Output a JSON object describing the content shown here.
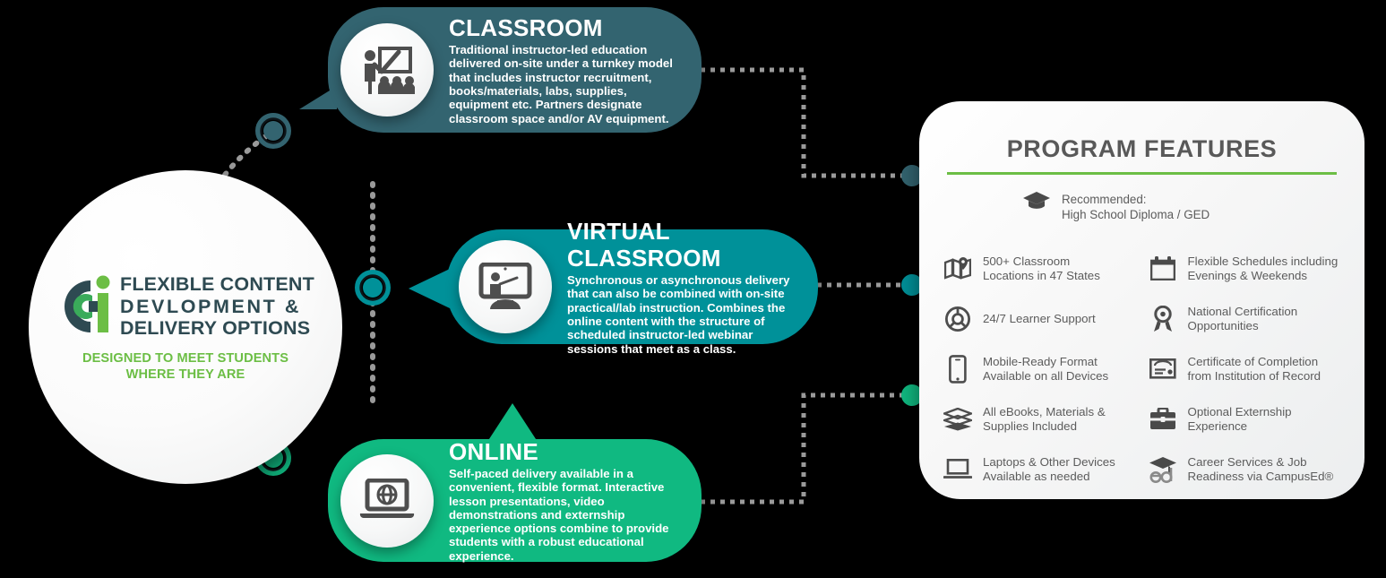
{
  "hub": {
    "logo_name": "cci-logo",
    "title_line1": "FLEXIBLE CONTENT",
    "title_line2": "DEVLOPMENT &",
    "title_line3": "DELIVERY OPTIONS",
    "subtitle_line1": "DESIGNED TO MEET STUDENTS",
    "subtitle_line2": "WHERE THEY ARE",
    "title_color": "#2e4a52",
    "subtitle_color": "#6cbe45"
  },
  "cards": [
    {
      "key": "classroom",
      "heading": "CLASSROOM",
      "body": "Traditional instructor-led education delivered on-site under a turnkey model that includes instructor recruitment, books/materials, labs, supplies, equipment etc. Partners designate classroom space and/or AV equipment.",
      "color": "#336470",
      "icon": "instructor-whiteboard-icon"
    },
    {
      "key": "virtual-classroom",
      "heading": "VIRTUAL CLASSROOM",
      "body": "Synchronous or asynchronous delivery that can also be combined with on-site practical/lab instruction. Combines the online content with the structure of scheduled instructor-led webinar sessions that meet as a class.",
      "color": "#009199",
      "icon": "monitor-presenter-icon"
    },
    {
      "key": "online",
      "heading": "ONLINE",
      "body": "Self-paced delivery available in a convenient, flexible format. Interactive lesson presentations, video demonstrations and externship experience options combine to provide students with a robust educational experience.",
      "color": "#10b981",
      "icon": "laptop-globe-icon"
    }
  ],
  "connectors": {
    "ring_colors": [
      "#336470",
      "#009199",
      "#10b981"
    ],
    "dot_colors": [
      "#336470",
      "#009199",
      "#10b981"
    ],
    "dash_color": "#9a9a9a"
  },
  "panel": {
    "title": "PROGRAM FEATURES",
    "title_color": "#595959",
    "rule_color": "#6cbe45",
    "recommended": {
      "icon": "graduation-cap-icon",
      "line1": "Recommended:",
      "line2": "High School Diploma / GED"
    },
    "features": [
      {
        "icon": "map-pin-icon",
        "line1": "500+ Classroom",
        "line2": "Locations in 47 States"
      },
      {
        "icon": "calendar-icon",
        "line1": "Flexible Schedules including",
        "line2": "Evenings & Weekends"
      },
      {
        "icon": "life-ring-icon",
        "line1": "24/7 Learner Support",
        "line2": ""
      },
      {
        "icon": "award-ribbon-icon",
        "line1": "National Certification",
        "line2": "Opportunities"
      },
      {
        "icon": "mobile-phone-icon",
        "line1": "Mobile-Ready Format",
        "line2": "Available on all Devices"
      },
      {
        "icon": "certificate-icon",
        "line1": "Certificate of Completion",
        "line2": "from Institution of Record"
      },
      {
        "icon": "books-stack-icon",
        "line1": "All eBooks, Materials &",
        "line2": "Supplies Included"
      },
      {
        "icon": "briefcase-icon",
        "line1": "Optional Externship",
        "line2": "Experience"
      },
      {
        "icon": "laptop-icon",
        "line1": "Laptops & Other Devices",
        "line2": "Available as needed"
      },
      {
        "icon": "campused-cap-icon",
        "line1": "Career Services & Job",
        "line2": "Readiness via CampusEd®"
      }
    ]
  }
}
